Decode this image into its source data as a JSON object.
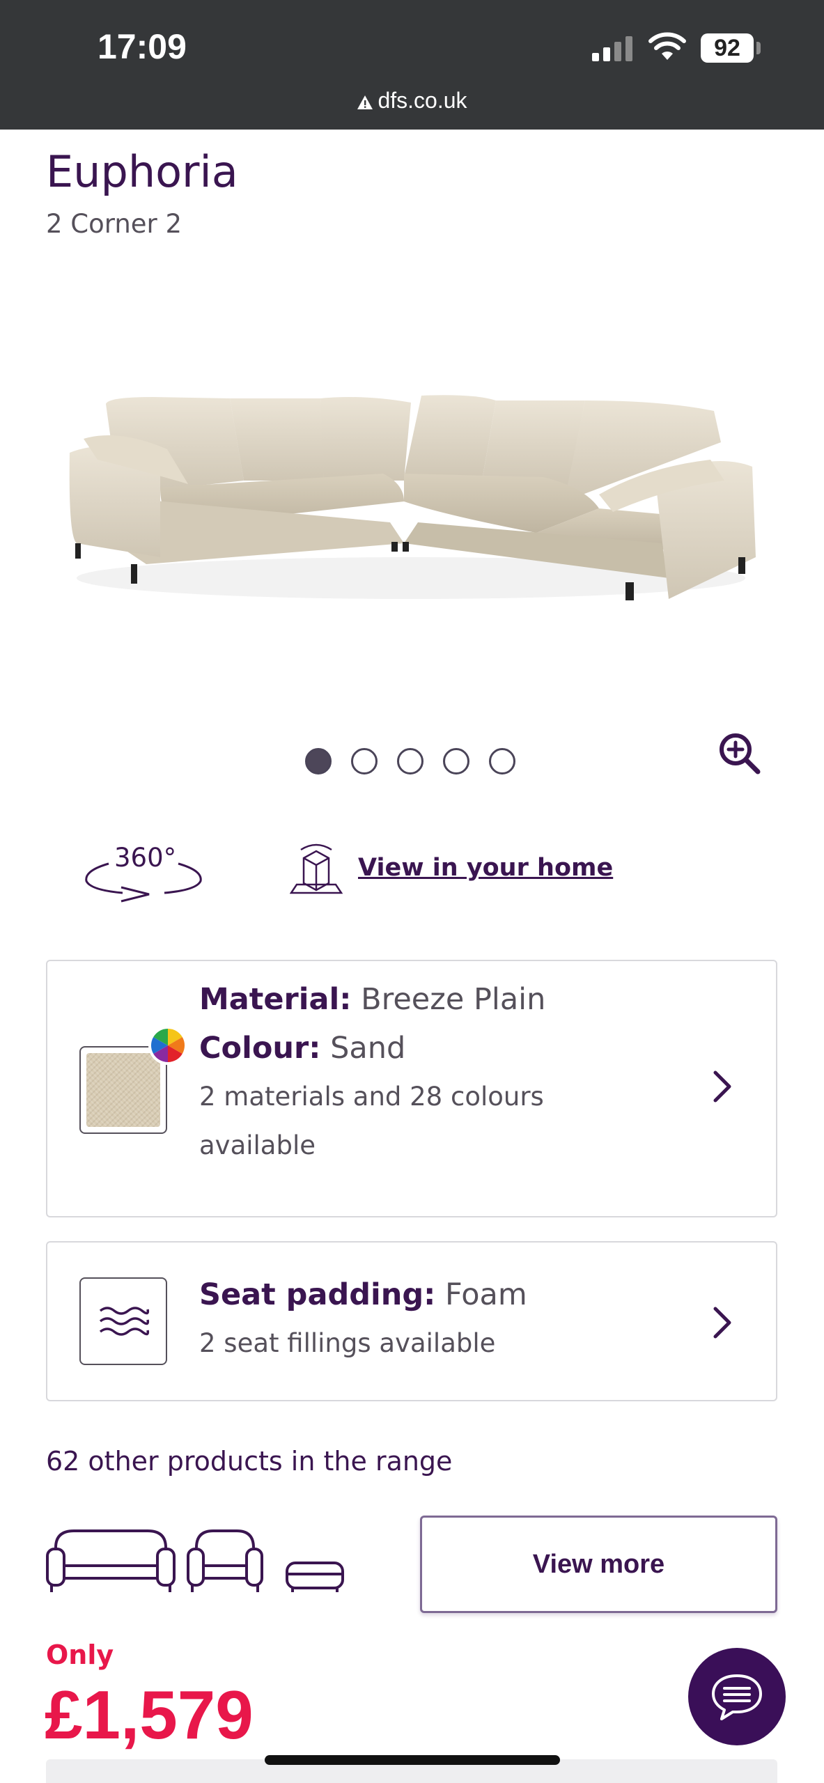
{
  "status_bar": {
    "time": "17:09",
    "battery": "92",
    "url": "dfs.co.uk"
  },
  "product": {
    "name": "Euphoria",
    "variant": "2 Corner 2",
    "image_icon": "corner-sofa-image",
    "carousel": {
      "total": 5,
      "active": 1
    }
  },
  "actions": {
    "view_360_label": "360°",
    "view_in_home": "View in your home"
  },
  "material_card": {
    "material_label": "Material:",
    "material_value": "Breeze Plain",
    "colour_label": "Colour:",
    "colour_value": "Sand",
    "availability_line1": "2 materials and 28 colours",
    "availability_line2": "available",
    "swatch_color": "#d8ccb4"
  },
  "padding_card": {
    "label": "Seat padding:",
    "value": "Foam",
    "availability": "2 seat fillings available"
  },
  "range": {
    "text": "62 other products in the range",
    "view_more": "View more"
  },
  "price": {
    "label": "Only",
    "value": "£1,579"
  },
  "colors": {
    "brand_purple": "#3a1550",
    "price_red": "#e8174a",
    "status_bar": "#353739",
    "chat_button": "#3a0f58"
  }
}
